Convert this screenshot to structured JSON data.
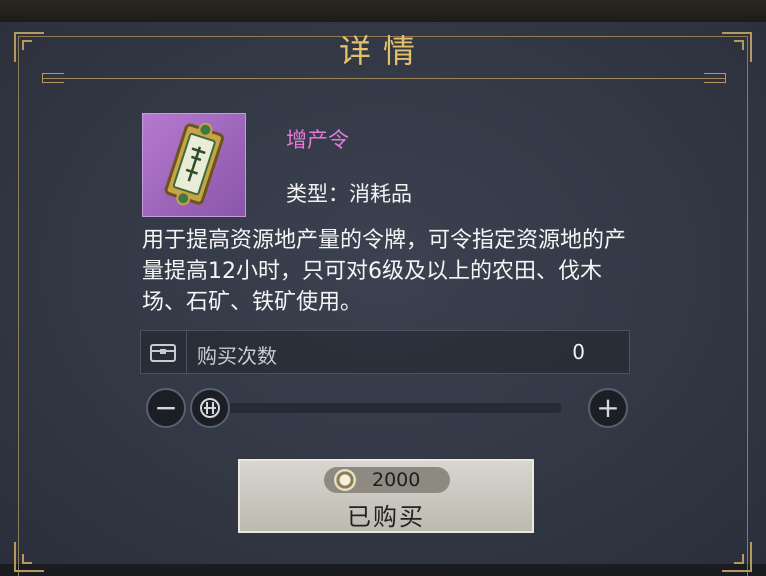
{
  "dialog": {
    "title": "详情"
  },
  "item": {
    "icon": "production-token-icon",
    "name": "增产令",
    "type_label": "类型：消耗品",
    "description": "用于提高资源地产量的令牌，可令指定资源地的产量提高12小时，只可对6级及以上的农田、伐木场、石矿、铁矿使用。"
  },
  "purchase_count": {
    "icon": "chest-icon",
    "label": "购买次数",
    "value": "0",
    "slider_fraction": 0
  },
  "buy_button": {
    "price": "2000",
    "currency_icon": "silver-coin-icon",
    "label": "已购买"
  },
  "colors": {
    "title": "#e3c06b",
    "item_name": "#e47ad8",
    "frame_gold": "#b59a5f"
  }
}
